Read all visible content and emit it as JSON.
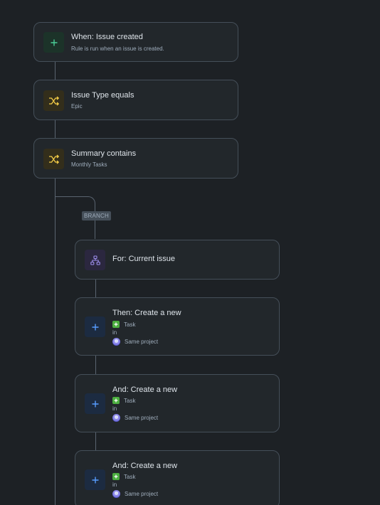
{
  "trigger": {
    "title": "When: Issue created",
    "subtitle": "Rule is run when an issue is created.",
    "icon": "plus-icon",
    "color": "#4bce97"
  },
  "conditions": [
    {
      "title": "Issue Type equals",
      "subtitle": "Epic",
      "icon": "shuffle-icon",
      "color": "#f5cd47"
    },
    {
      "title": "Summary contains",
      "subtitle": "Monthly Tasks",
      "icon": "shuffle-icon",
      "color": "#f5cd47"
    }
  ],
  "branch": {
    "tag": "BRANCH",
    "title": "For: Current issue",
    "icon": "hierarchy-icon",
    "color": "#9f8fef"
  },
  "actions": [
    {
      "title": "Then: Create a new",
      "issue_type": "Task",
      "in_label": "in",
      "project": "Same project"
    },
    {
      "title": "And: Create a new",
      "issue_type": "Task",
      "in_label": "in",
      "project": "Same project"
    },
    {
      "title": "And: Create a new",
      "issue_type": "Task",
      "in_label": "in",
      "project": "Same project"
    }
  ]
}
